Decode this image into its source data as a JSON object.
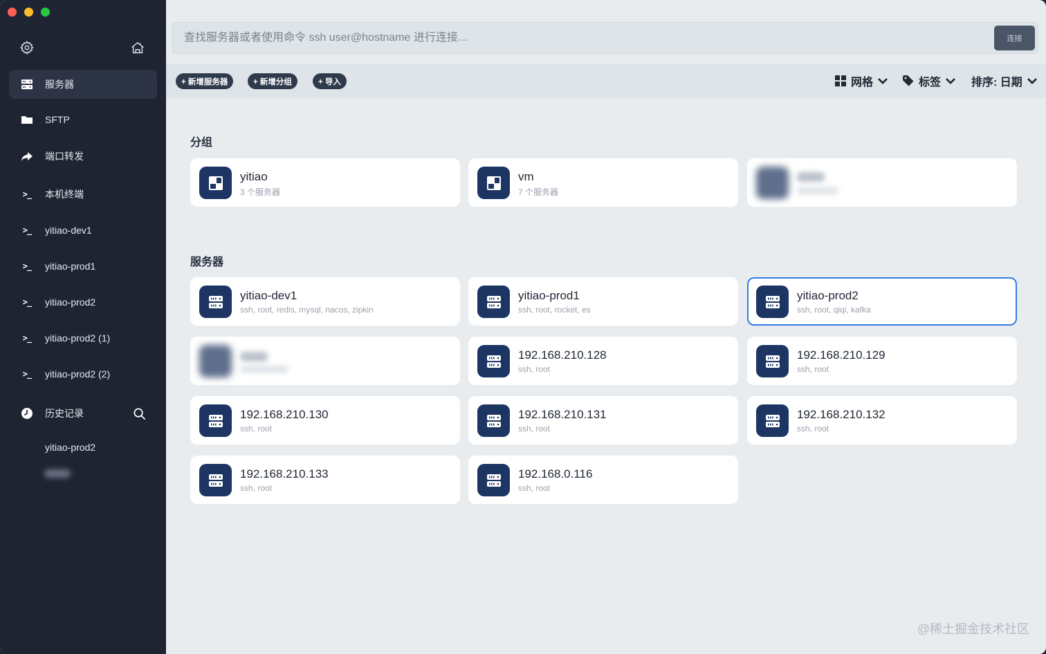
{
  "sidebar": {
    "items": [
      {
        "label": "服务器",
        "icon": "server-icon"
      },
      {
        "label": "SFTP",
        "icon": "folder-icon"
      },
      {
        "label": "端口转发",
        "icon": "forward-icon"
      },
      {
        "label": "本机终端",
        "icon": "terminal-icon"
      },
      {
        "label": "yitiao-dev1",
        "icon": "terminal-icon"
      },
      {
        "label": "yitiao-prod1",
        "icon": "terminal-icon"
      },
      {
        "label": "yitiao-prod2",
        "icon": "terminal-icon"
      },
      {
        "label": "yitiao-prod2 (1)",
        "icon": "terminal-icon"
      },
      {
        "label": "yitiao-prod2 (2)",
        "icon": "terminal-icon"
      }
    ],
    "history_label": "历史记录",
    "history_items": [
      "yitiao-prod2"
    ]
  },
  "search": {
    "placeholder": "查找服务器或者使用命令 ssh user@hostname 进行连接...",
    "connect_label": "连接"
  },
  "toolbar": {
    "add_server": "+ 新增服务器",
    "add_group": "+ 新增分组",
    "import": "+ 导入",
    "view_grid": "网格",
    "tags": "标签",
    "sort": "排序: 日期"
  },
  "groups": {
    "title": "分组",
    "items": [
      {
        "name": "yitiao",
        "sub": "3 个服务器"
      },
      {
        "name": "vm",
        "sub": "7 个服务器"
      },
      {
        "name": "",
        "sub": ""
      }
    ]
  },
  "servers": {
    "title": "服务器",
    "items": [
      {
        "name": "yitiao-dev1",
        "sub": "ssh, root, redis, mysql, nacos, zipkin"
      },
      {
        "name": "yitiao-prod1",
        "sub": "ssh, root, rocket, es"
      },
      {
        "name": "yitiao-prod2",
        "sub": "ssh, root, qiqi, kafka"
      },
      {
        "name": "",
        "sub": ""
      },
      {
        "name": "192.168.210.128",
        "sub": "ssh, root"
      },
      {
        "name": "192.168.210.129",
        "sub": "ssh, root"
      },
      {
        "name": "192.168.210.130",
        "sub": "ssh, root"
      },
      {
        "name": "192.168.210.131",
        "sub": "ssh, root"
      },
      {
        "name": "192.168.210.132",
        "sub": "ssh, root"
      },
      {
        "name": "192.168.210.133",
        "sub": "ssh, root"
      },
      {
        "name": "192.168.0.116",
        "sub": "ssh, root"
      }
    ]
  },
  "watermark": "@稀土掘金技术社区",
  "colors": {
    "accent": "#2f7de1",
    "icon_bg": "#1d3563",
    "sidebar_bg": "#1f2433"
  }
}
